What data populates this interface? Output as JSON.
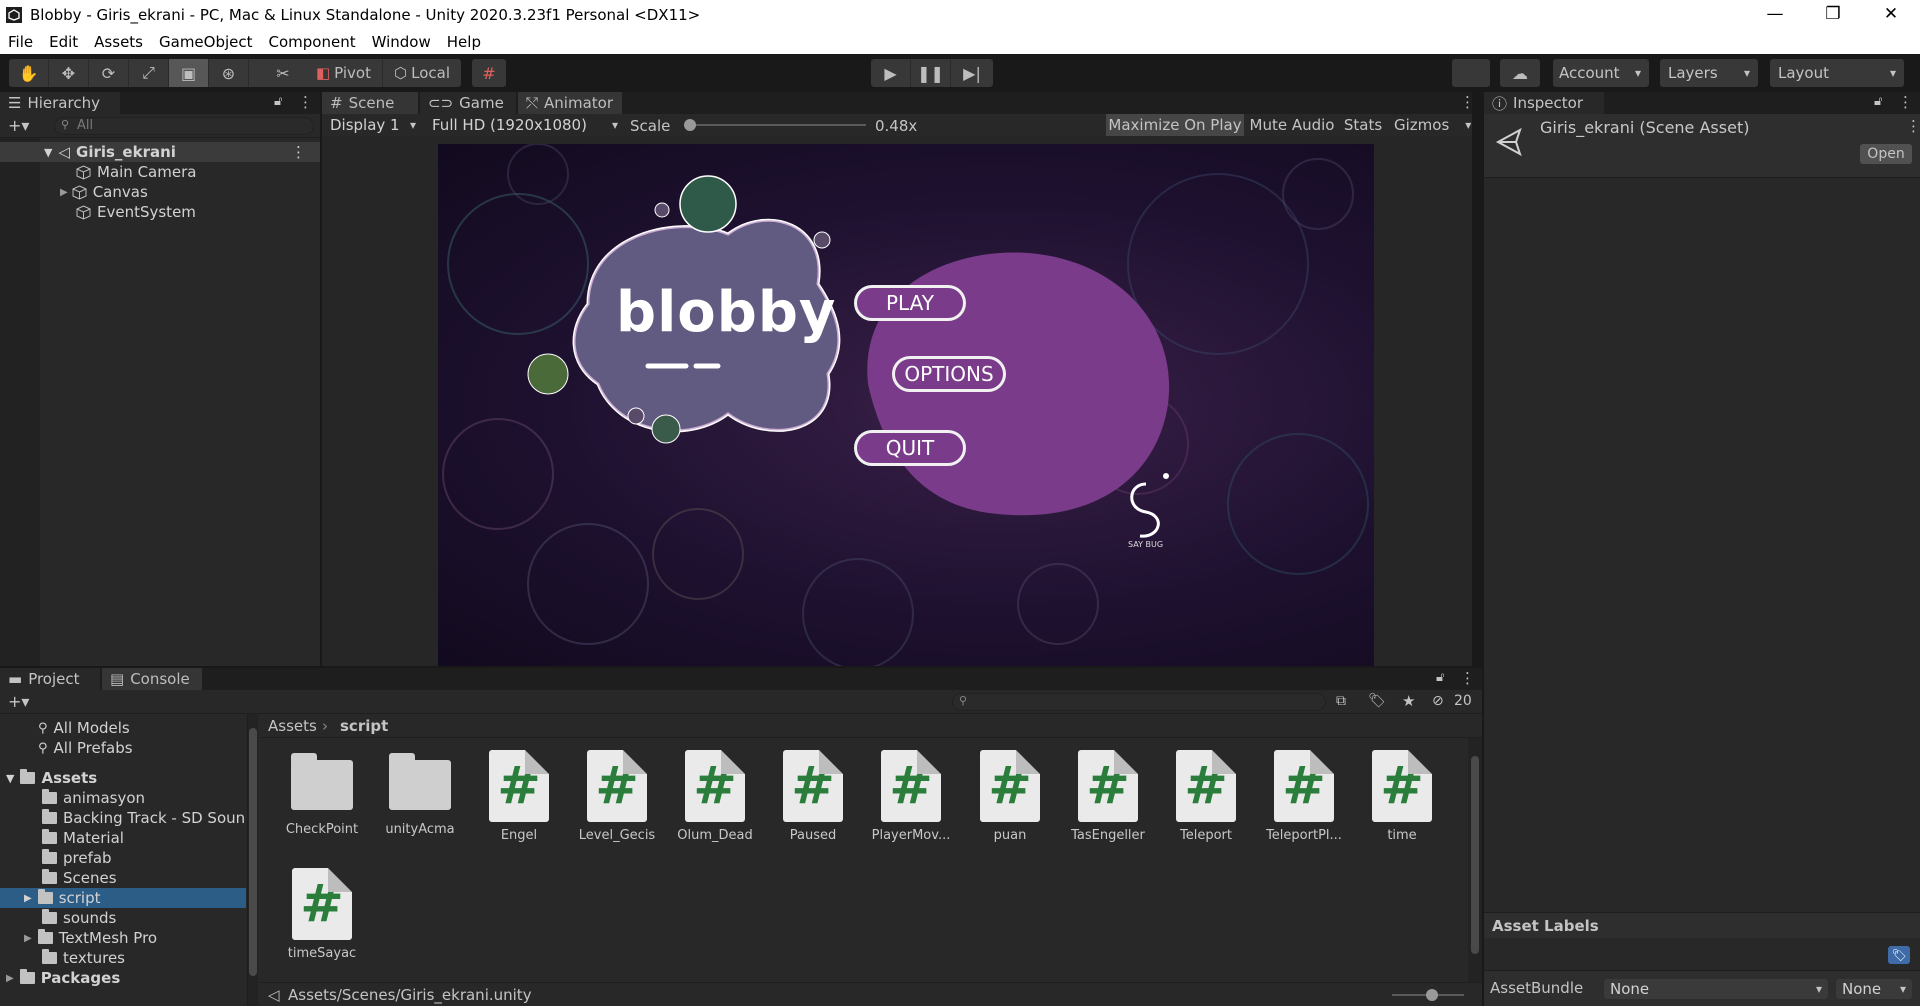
{
  "window": {
    "title": "Blobby - Giris_ekrani - PC, Mac & Linux Standalone - Unity 2020.3.23f1 Personal <DX11>",
    "minimize": "—",
    "restore": "❐",
    "close": "✕"
  },
  "menu": [
    "File",
    "Edit",
    "Assets",
    "GameObject",
    "Component",
    "Window",
    "Help"
  ],
  "toolbar": {
    "pivot": "Pivot",
    "local": "Local",
    "account": "Account",
    "layers": "Layers",
    "layout": "Layout"
  },
  "hierarchy": {
    "tab": "Hierarchy",
    "search_placeholder": "All",
    "scene": "Giris_ekrani",
    "items": [
      "Main Camera",
      "Canvas",
      "EventSystem"
    ]
  },
  "game_view": {
    "tabs": [
      "Scene",
      "Game",
      "Animator"
    ],
    "display": "Display 1",
    "resolution": "Full HD (1920x1080)",
    "scale_label": "Scale",
    "scale_value": "0.48x",
    "scale_level": 0.0,
    "maximize": "Maximize On Play",
    "mute": "Mute Audio",
    "stats": "Stats",
    "gizmos": "Gizmos",
    "game": {
      "logo": "blobby",
      "play": "PLAY",
      "options": "OPTIONS",
      "quit": "QUIT",
      "studio": "SAY BUG"
    }
  },
  "inspector": {
    "tab": "Inspector",
    "asset_name": "Giris_ekrani (Scene Asset)",
    "open": "Open",
    "asset_labels": "Asset Labels",
    "assetbundle_label": "AssetBundle",
    "assetbundle_value": "None",
    "variant_value": "None"
  },
  "project": {
    "tabs": [
      "Project",
      "Console"
    ],
    "favorites": [
      "All Models",
      "All Prefabs"
    ],
    "assets_root": "Assets",
    "folders": [
      "animasyon",
      "Backing Track - SD Soun",
      "Material",
      "prefab",
      "Scenes",
      "script",
      "sounds",
      "TextMesh Pro",
      "textures"
    ],
    "packages": "Packages",
    "breadcrumb": [
      "Assets",
      "script"
    ],
    "hidden_count": "20",
    "files": [
      {
        "name": "CheckPoint",
        "type": "folder"
      },
      {
        "name": "unityAcma",
        "type": "folder"
      },
      {
        "name": "Engel",
        "type": "script"
      },
      {
        "name": "Level_Gecis",
        "type": "script"
      },
      {
        "name": "Olum_Dead",
        "type": "script"
      },
      {
        "name": "Paused",
        "type": "script"
      },
      {
        "name": "PlayerMov...",
        "type": "script"
      },
      {
        "name": "puan",
        "type": "script"
      },
      {
        "name": "TasEngeller",
        "type": "script"
      },
      {
        "name": "Teleport",
        "type": "script"
      },
      {
        "name": "TeleportPl...",
        "type": "script"
      },
      {
        "name": "time",
        "type": "script"
      },
      {
        "name": "timeSayac",
        "type": "script"
      }
    ],
    "status_path": "Assets/Scenes/Giris_ekrani.unity"
  }
}
